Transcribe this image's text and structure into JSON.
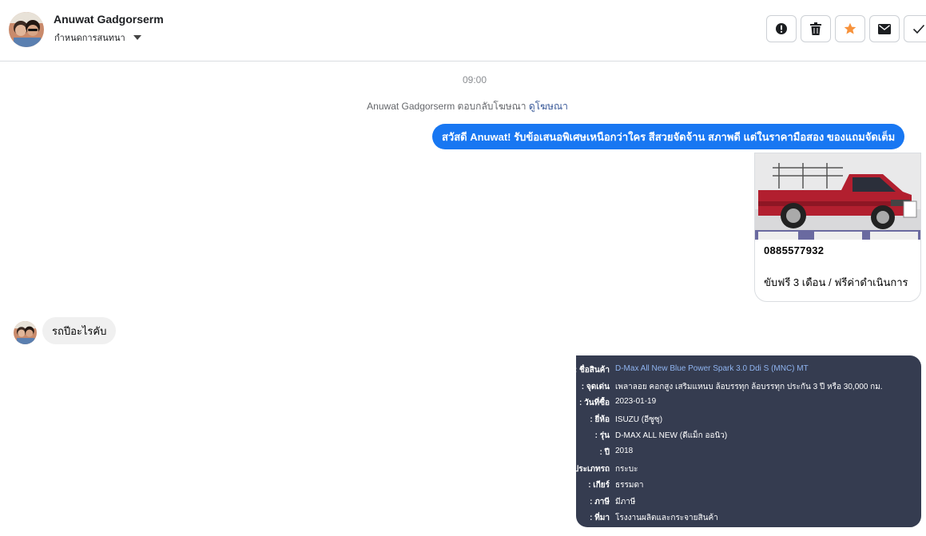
{
  "header": {
    "name": "Anuwat Gadgorserm",
    "subtitle": "กำหนดการสนทนา",
    "actions": [
      {
        "name": "report-icon",
        "label": "report"
      },
      {
        "name": "trash-icon",
        "label": "delete"
      },
      {
        "name": "star-icon",
        "label": "star"
      },
      {
        "name": "mail-icon",
        "label": "mark unread"
      },
      {
        "name": "check-icon",
        "label": "done"
      }
    ],
    "star_color": "#f7923b"
  },
  "conversation": {
    "time": "09:00",
    "note_text": "Anuwat Gadgorserm ตอบกลับโฆษณา",
    "note_link": "ดูโฆษณา",
    "outgoing_message": "สวัสดี Anuwat! รับข้อเสนอพิเศษเหนือกว่าใคร สีสวยจัดจ้าน สภาพดี แต่ในราคามือสอง ของแถมจัดเต็ม",
    "outgoing_color": "#1877f2",
    "card": {
      "title": "0885577932",
      "description": "ขับฟรี 3 เดือน / ฟรีค่าดำเนินการ"
    },
    "incoming_message": "รถปีอะไรคับ",
    "spec_rows": [
      {
        "label": "ชื่อสินค้า :",
        "value": "D-Max All New Blue Power Spark 3.0 Ddi S (MNC) MT"
      },
      {
        "label": "จุดเด่น :",
        "value": "เพลาลอย คอกสูง เสริมแหนบ ล้อบรรทุก ล้อบรรทุก ประกัน 3 ปี หรือ 30,000 กม."
      },
      {
        "label": "วันที่ซื้อ :",
        "value": "2023-01-19"
      },
      {
        "label": "ยี่ห้อ :",
        "value": "ISUZU (อีซูซุ)"
      },
      {
        "label": "รุ่น :",
        "value": "D-MAX ALL NEW (ดีแม็ก ออนิว)"
      },
      {
        "label": "ปี :",
        "value": "2018"
      },
      {
        "label": "ประเภทรถ :",
        "value": "กระบะ"
      },
      {
        "label": "เกียร์ :",
        "value": "ธรรมดา"
      },
      {
        "label": "ภาษี :",
        "value": "มีภาษี"
      },
      {
        "label": "ที่มา :",
        "value": "โรงงานผลิตและกระจายสินค้า"
      }
    ]
  }
}
